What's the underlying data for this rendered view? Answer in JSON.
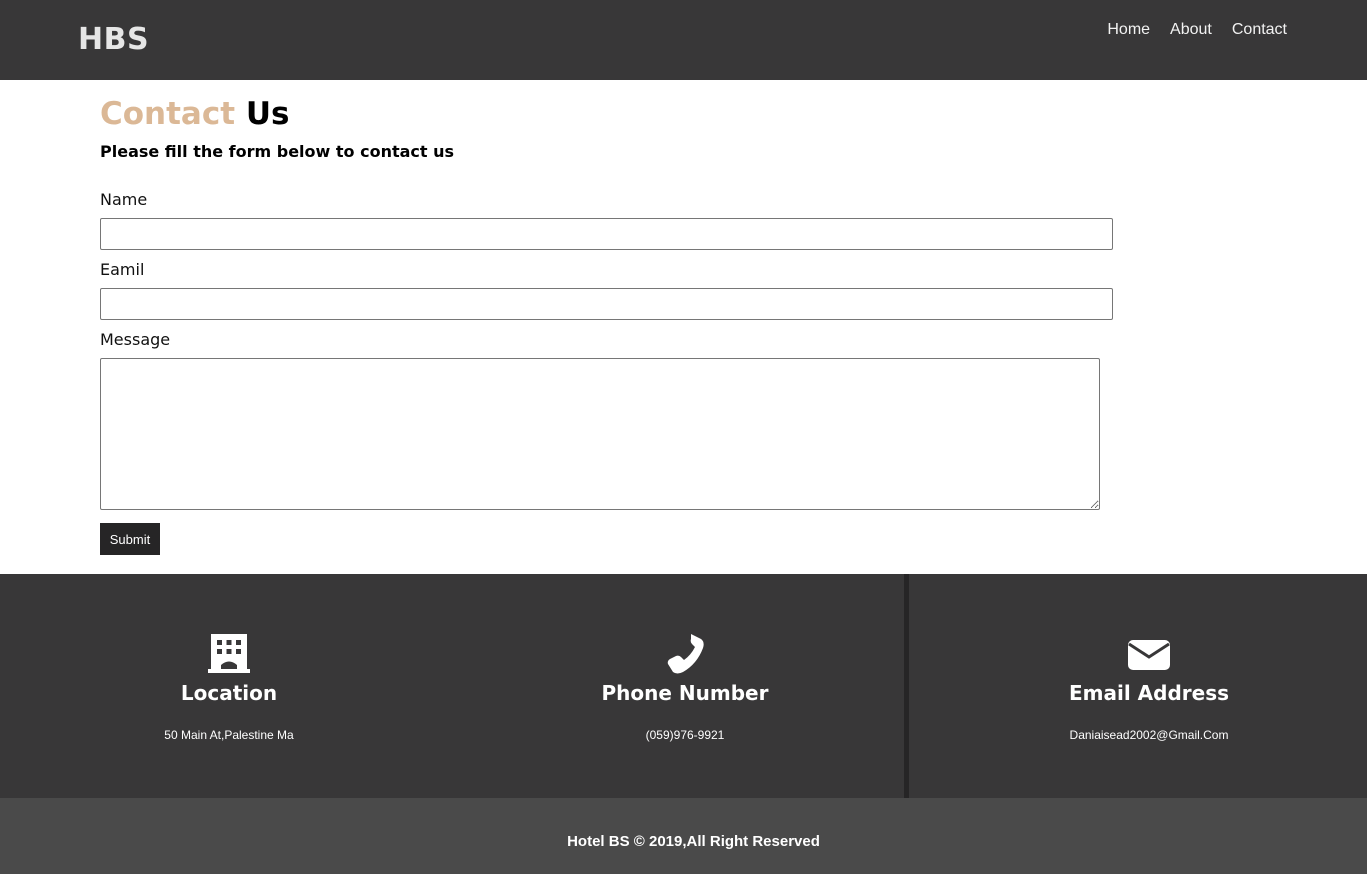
{
  "header": {
    "brand": "HBS",
    "nav": [
      {
        "label": "Home"
      },
      {
        "label": "About"
      },
      {
        "label": "Contact"
      }
    ]
  },
  "main": {
    "title_accent": "Contact",
    "title_rest": "Us",
    "subtitle": "Please fill the form below to contact us",
    "form": {
      "name_label": "Name",
      "name_value": "",
      "email_label": "Eamil",
      "email_value": "",
      "message_label": "Message",
      "message_value": "",
      "submit_label": "Submit"
    }
  },
  "info": [
    {
      "icon": "building-icon",
      "title": "Location",
      "value": "50 Main At,Palestine Ma"
    },
    {
      "icon": "phone-icon",
      "title": "Phone Number",
      "value": "(059)976-9921"
    },
    {
      "icon": "envelope-icon",
      "title": "Email Address",
      "value": "Daniaisead2002@Gmail.Com"
    }
  ],
  "footer": {
    "copyright": "Hotel BS © 2019,All Right Reserved"
  },
  "colors": {
    "header_bg": "#383738",
    "accent": "#dbb896",
    "footer_bg": "#4a4a4a",
    "button_bg": "#262526"
  }
}
